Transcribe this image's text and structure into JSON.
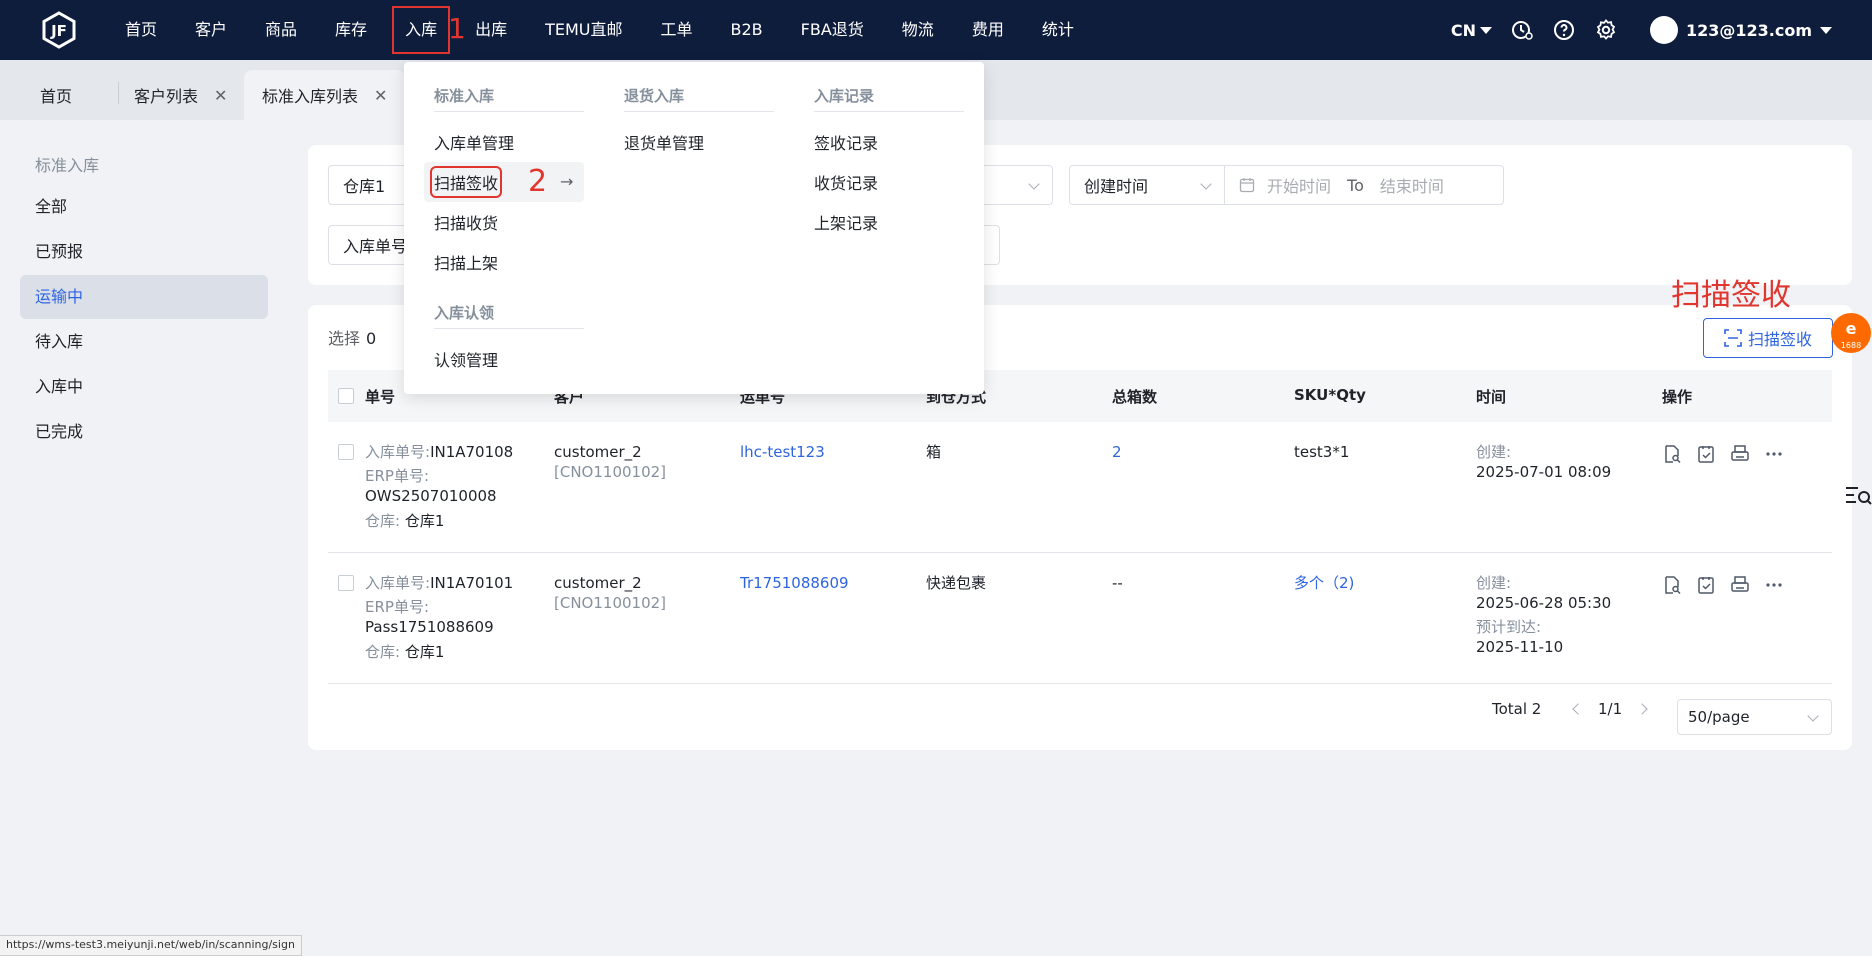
{
  "nav": {
    "items": [
      "首页",
      "客户",
      "商品",
      "库存",
      "入库",
      "出库",
      "TEMU直邮",
      "工单",
      "B2B",
      "FBA退货",
      "物流",
      "费用",
      "统计"
    ],
    "lang": "CN",
    "user": "123@123.com",
    "anno1": "1"
  },
  "tabs": [
    {
      "label": "首页"
    },
    {
      "label": "客户列表",
      "close": "✕"
    },
    {
      "label": "标准入库列表",
      "close": "✕"
    }
  ],
  "sidebar": {
    "title": "标准入库",
    "items": [
      "全部",
      "已预报",
      "运输中",
      "待入库",
      "入库中",
      "已完成"
    ],
    "active_index": 2
  },
  "filters": {
    "warehouse": "仓库1",
    "order_type": "入库单号",
    "time_type": "创建时间",
    "start_placeholder": "开始时间",
    "to": "To",
    "end_placeholder": "结束时间"
  },
  "menu": {
    "groups": {
      "standard": {
        "title": "标准入库",
        "items": [
          "入库单管理",
          "扫描签收",
          "扫描收货",
          "扫描上架"
        ]
      },
      "claim": {
        "title": "入库认领",
        "items": [
          "认领管理"
        ]
      },
      "returns": {
        "title": "退货入库",
        "items": [
          "退货单管理"
        ]
      },
      "records": {
        "title": "入库记录",
        "items": [
          "签收记录",
          "收货记录",
          "上架记录"
        ]
      }
    },
    "anno2": "2",
    "arrow": "→"
  },
  "table": {
    "select_label": "选择",
    "select_count": "0",
    "scan_button": "扫描签收",
    "annotation_title": "扫描签收",
    "headers": [
      "单号",
      "客户",
      "运单号",
      "到仓方式",
      "总箱数",
      "SKU*Qty",
      "时间",
      "操作"
    ],
    "rows": [
      {
        "inbound_label": "入库单号:",
        "inbound_no": "IN1A70108",
        "erp_label": "ERP单号:",
        "erp_no": "OWS2507010008",
        "wh_label": "仓库:",
        "wh": "仓库1",
        "customer": "customer_2",
        "customer_code": "[CNO1100102]",
        "tracking": "lhc-test123",
        "method": "箱",
        "boxes": "2",
        "sku": "test3*1",
        "created_label": "创建:",
        "created": "2025-07-01 08:09"
      },
      {
        "inbound_label": "入库单号:",
        "inbound_no": "IN1A70101",
        "erp_label": "ERP单号:",
        "erp_no": "Pass1751088609",
        "wh_label": "仓库:",
        "wh": "仓库1",
        "customer": "customer_2",
        "customer_code": "[CNO1100102]",
        "tracking": "Tr1751088609",
        "method": "快递包裹",
        "boxes": "--",
        "sku": "多个（2)",
        "created_label": "创建:",
        "created": "2025-06-28 05:30",
        "eta_label": "预计到达:",
        "eta": "2025-11-10"
      }
    ],
    "pagination": {
      "total": "Total 2",
      "page": "1/1",
      "page_size": "50/page"
    }
  },
  "status_url": "https://wms-test3.meiyunji.net/web/in/scanning/sign",
  "colors": {
    "nav_bg": "#0f1d3d",
    "accent": "#2f64e0",
    "annotation": "#e0362f"
  }
}
